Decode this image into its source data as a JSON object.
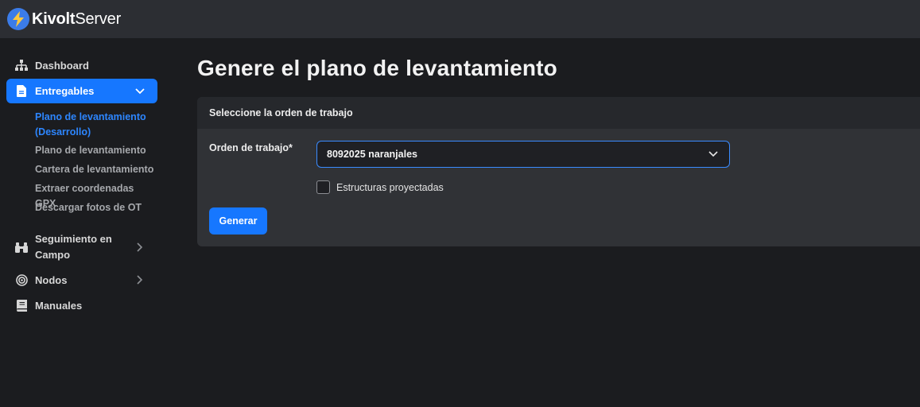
{
  "app": {
    "brand_bold": "Kivolt",
    "brand_light": "Server"
  },
  "colors": {
    "accent": "#1677ff",
    "topbar": "#2c2e33",
    "background": "#1b1c1f",
    "card": "#303236",
    "card_header": "#26282c",
    "active_link": "#2d86ff"
  },
  "sidebar": {
    "items": [
      {
        "label": "Dashboard",
        "icon": "sitemap-icon"
      },
      {
        "label": "Entregables",
        "icon": "file-icon",
        "active": true,
        "expanded": true
      },
      {
        "label": "Seguimiento en Campo",
        "icon": "binoculars-icon"
      },
      {
        "label": "Nodos",
        "icon": "target-icon"
      },
      {
        "label": "Manuales",
        "icon": "book-icon"
      }
    ],
    "subitems": [
      {
        "label": "Plano de levantamiento (Desarrollo)",
        "current": true
      },
      {
        "label": "Plano de levantamiento"
      },
      {
        "label": "Cartera de levantamiento"
      },
      {
        "label": "Extraer coordenadas GPX"
      },
      {
        "label": "Descargar fotos de OT"
      }
    ]
  },
  "main": {
    "title": "Genere el plano de levantamiento",
    "card": {
      "header": "Seleccione la orden de trabajo",
      "order_label": "Orden de trabajo*",
      "order_value": "8092025 naranjales",
      "checkbox_label": "Estructuras proyectadas",
      "checkbox_checked": false,
      "submit_label": "Generar"
    }
  }
}
